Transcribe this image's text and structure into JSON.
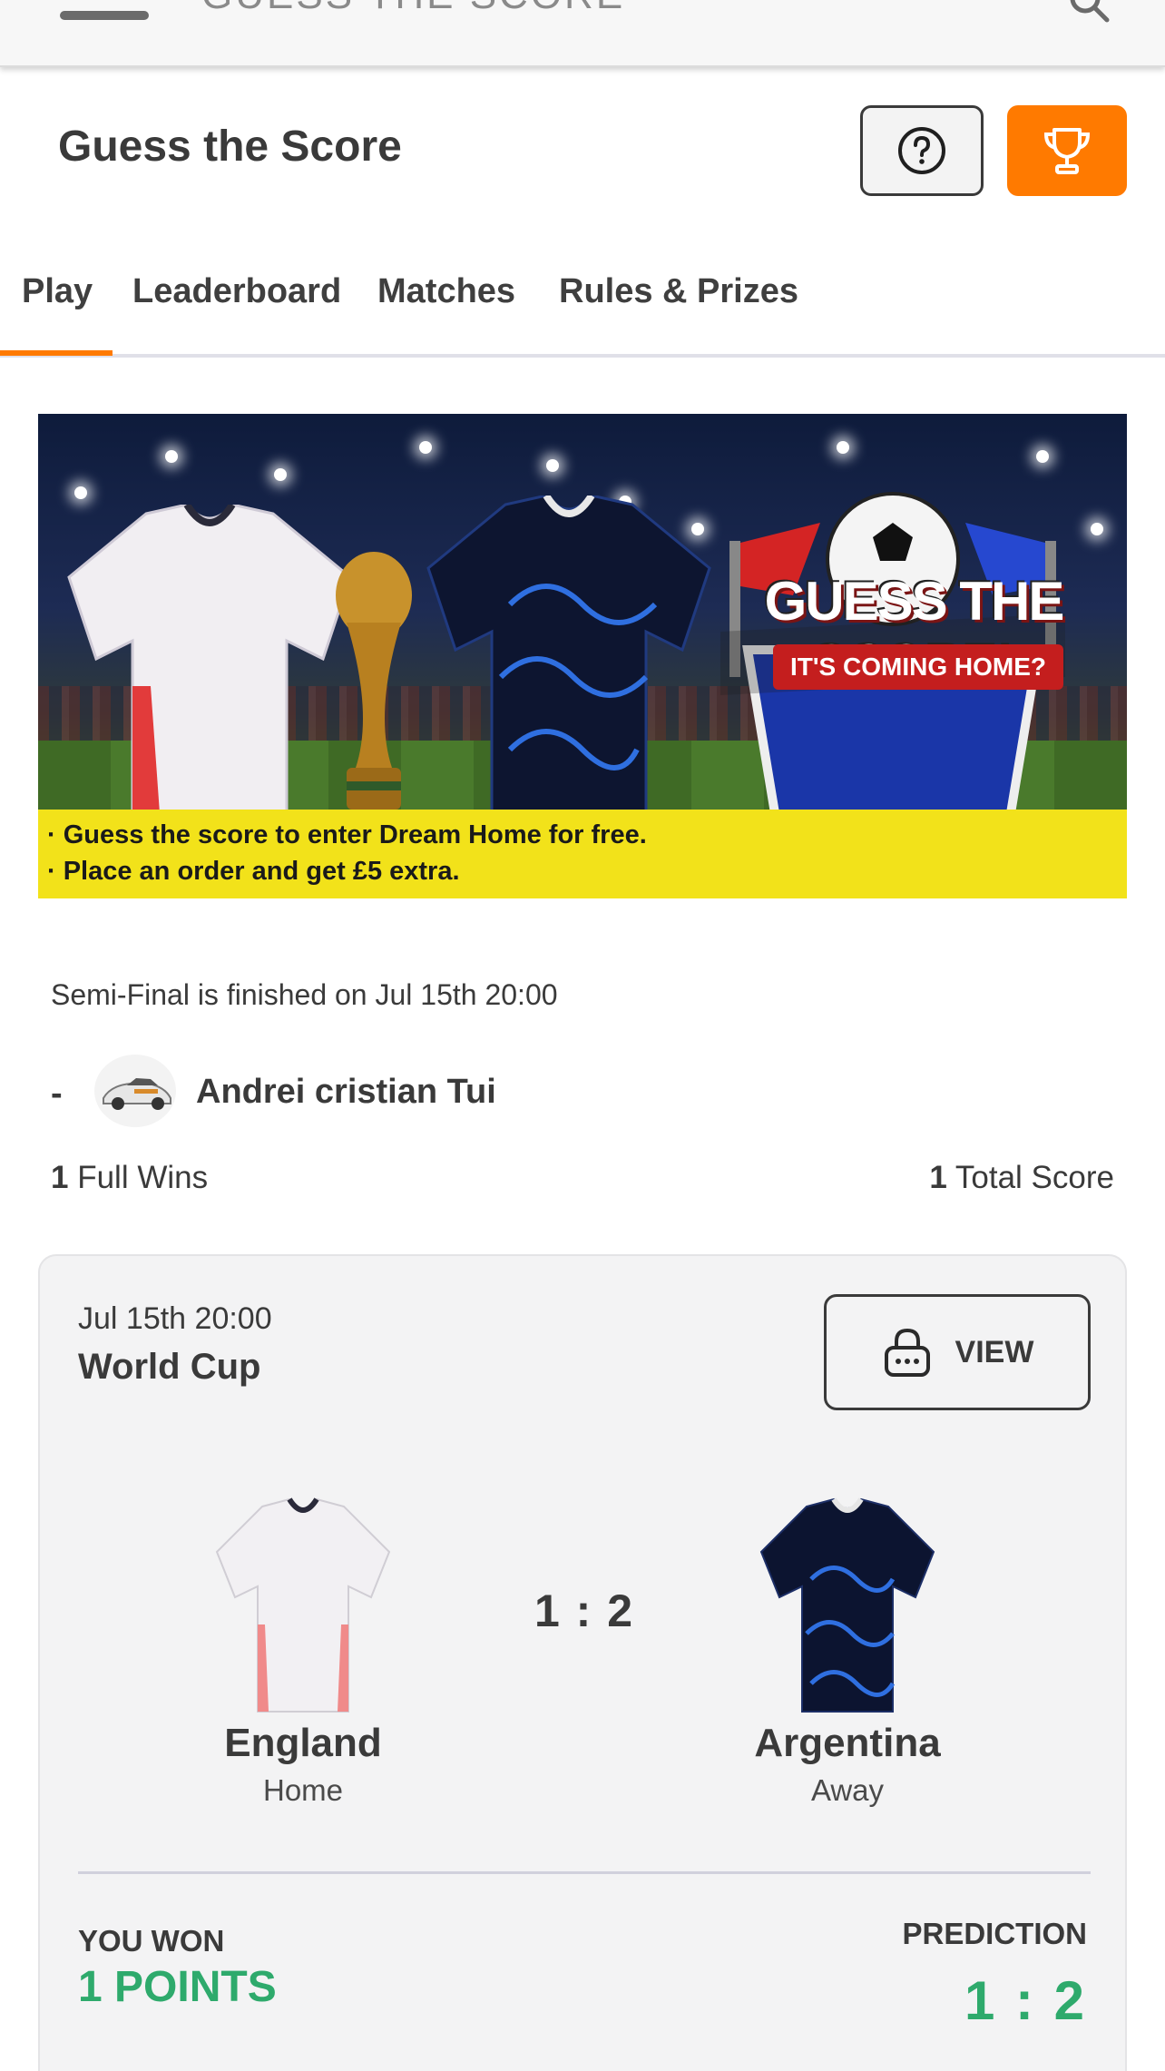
{
  "appbar": {
    "title": "GUESS THE SCORE"
  },
  "header": {
    "title": "Guess the Score",
    "help_icon": "question-circle-icon",
    "trophy_icon": "trophy-icon"
  },
  "tabs": [
    {
      "label": "Play",
      "active": true
    },
    {
      "label": "Leaderboard",
      "active": false
    },
    {
      "label": "Matches",
      "active": false
    },
    {
      "label": "Rules & Prizes",
      "active": false
    }
  ],
  "banner": {
    "logo_title": "GUESS THE SCORE!",
    "logo_subtitle": "IT'S COMING HOME?",
    "line1": "· Guess the score to enter Dream Home for free.",
    "line2": "· Place an order and get £5 extra."
  },
  "status": {
    "finish_text": "Semi-Final is finished on Jul 15th 20:00"
  },
  "user": {
    "rank": "-",
    "name": "Andrei cristian Tui"
  },
  "stats": {
    "full_wins_value": "1",
    "full_wins_label": "Full Wins",
    "total_score_value": "1",
    "total_score_label": "Total Score"
  },
  "match": {
    "date": "Jul 15th 20:00",
    "competition": "World Cup",
    "view_label": "VIEW",
    "home_team": "England",
    "home_label": "Home",
    "away_team": "Argentina",
    "away_label": "Away",
    "score": "1 : 2",
    "won_label": "YOU WON",
    "won_value": "1 POINTS",
    "prediction_label": "PREDICTION",
    "prediction_value": "1 : 2"
  },
  "colors": {
    "accent": "#ff7a00",
    "success": "#2eaa6c",
    "text": "#3a3a3a"
  }
}
